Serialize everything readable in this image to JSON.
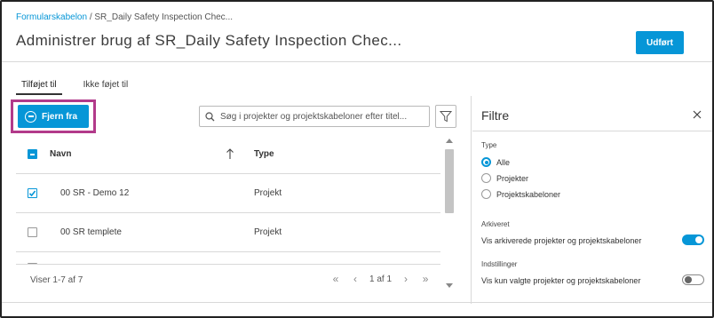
{
  "breadcrumb": {
    "link": "Formularskabelon",
    "separator": " / ",
    "current": "SR_Daily Safety Inspection Chec..."
  },
  "header": {
    "title": "Administrer brug af SR_Daily Safety Inspection Chec...",
    "done_label": "Udført"
  },
  "tabs": [
    {
      "label": "Tilføjet til",
      "active": true
    },
    {
      "label": "Ikke føjet til",
      "active": false
    }
  ],
  "toolbar": {
    "remove_label": "Fjern fra",
    "search_placeholder": "Søg i projekter og projektskabeloner efter titel..."
  },
  "table": {
    "columns": {
      "name": "Navn",
      "type": "Type"
    },
    "rows": [
      {
        "name": "00 SR - Demo 12",
        "type": "Projekt",
        "checked": true
      },
      {
        "name": "00 SR templete",
        "type": "Projekt",
        "checked": false
      }
    ],
    "footer_count": "Viser 1-7 af 7",
    "pager": {
      "page_text": "1 af 1"
    }
  },
  "filters": {
    "title": "Filtre",
    "type_label": "Type",
    "type_options": [
      {
        "label": "Alle",
        "selected": true
      },
      {
        "label": "Projekter",
        "selected": false
      },
      {
        "label": "Projektskabeloner",
        "selected": false
      }
    ],
    "archived_label": "Arkiveret",
    "archived_toggle_text": "Vis arkiverede projekter og projektskabeloner",
    "archived_on": true,
    "settings_label": "Indstillinger",
    "settings_toggle_text": "Vis kun valgte projekter og projektskabeloner",
    "settings_on": false
  },
  "colors": {
    "accent": "#0696d7",
    "highlight": "#b23a8a"
  },
  "icons": [
    "minus-circle-icon",
    "search-icon",
    "filter-icon",
    "sort-up-icon",
    "close-icon",
    "first-page-icon",
    "prev-page-icon",
    "next-page-icon",
    "last-page-icon"
  ]
}
